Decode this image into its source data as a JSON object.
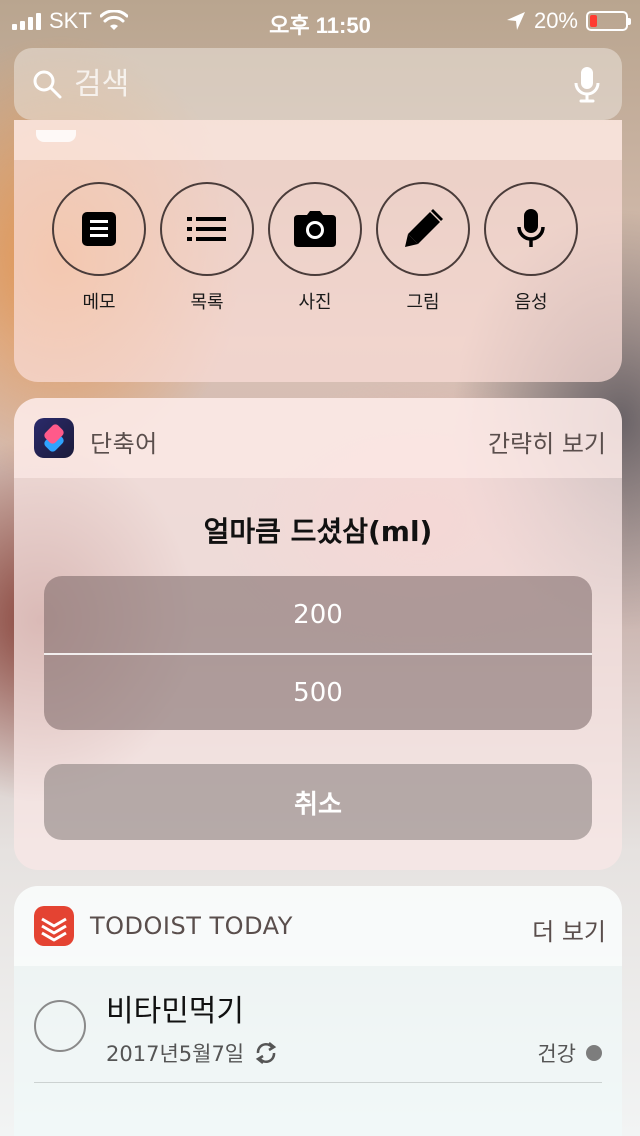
{
  "status_bar": {
    "carrier": "SKT",
    "time": "오후 11:50",
    "battery_percent": "20%",
    "battery_level": 0.2,
    "battery_color": "#ff3b30"
  },
  "search": {
    "placeholder": "검색",
    "search_icon": "magnifier-icon",
    "voice_icon": "microphone-icon"
  },
  "notes_widget": {
    "actions": [
      {
        "label": "메모",
        "icon": "note-icon"
      },
      {
        "label": "목록",
        "icon": "list-icon"
      },
      {
        "label": "사진",
        "icon": "camera-icon"
      },
      {
        "label": "그림",
        "icon": "pen-icon"
      },
      {
        "label": "음성",
        "icon": "microphone-icon"
      }
    ]
  },
  "shortcuts_widget": {
    "app_name": "단축어",
    "header_action": "간략히 보기",
    "prompt": "얼마큼 드셨삼(ml)",
    "choices": [
      "200",
      "500"
    ],
    "cancel": "취소"
  },
  "todoist_widget": {
    "app_name": "TODOIST TODAY",
    "header_action": "더 보기",
    "task": {
      "title": "비타민먹기",
      "date": "2017년5월7일",
      "project": "건강",
      "recurring_icon": "repeat-icon"
    },
    "brand_color": "#e44332"
  }
}
